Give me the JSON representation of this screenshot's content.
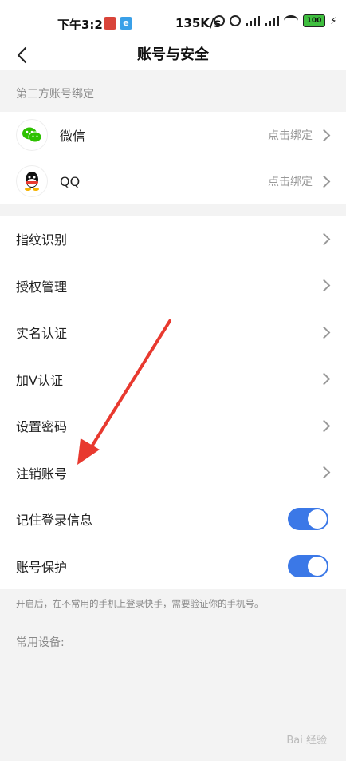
{
  "status_bar": {
    "time": "下午3:22",
    "app2": "e",
    "speed": "135K/s",
    "battery": "100"
  },
  "header": {
    "title": "账号与安全"
  },
  "third_party": {
    "section_title": "第三方账号绑定",
    "items": [
      {
        "name": "微信",
        "action": "点击绑定",
        "icon": "wechat-icon"
      },
      {
        "name": "QQ",
        "action": "点击绑定",
        "icon": "qq-icon"
      }
    ]
  },
  "menu": {
    "items": [
      {
        "label": "指纹识别"
      },
      {
        "label": "授权管理"
      },
      {
        "label": "实名认证"
      },
      {
        "label": "加V认证"
      },
      {
        "label": "设置密码"
      },
      {
        "label": "注销账号"
      }
    ]
  },
  "toggles": {
    "items": [
      {
        "label": "记住登录信息",
        "on": true
      },
      {
        "label": "账号保护",
        "on": true
      }
    ]
  },
  "note": "开启后，在不常用的手机上登录快手，需要验证你的手机号。",
  "devices": {
    "title": "常用设备:"
  },
  "watermark": "Bai 经验",
  "colors": {
    "accent": "#3b78e7",
    "annotation_arrow": "#e8392f"
  }
}
